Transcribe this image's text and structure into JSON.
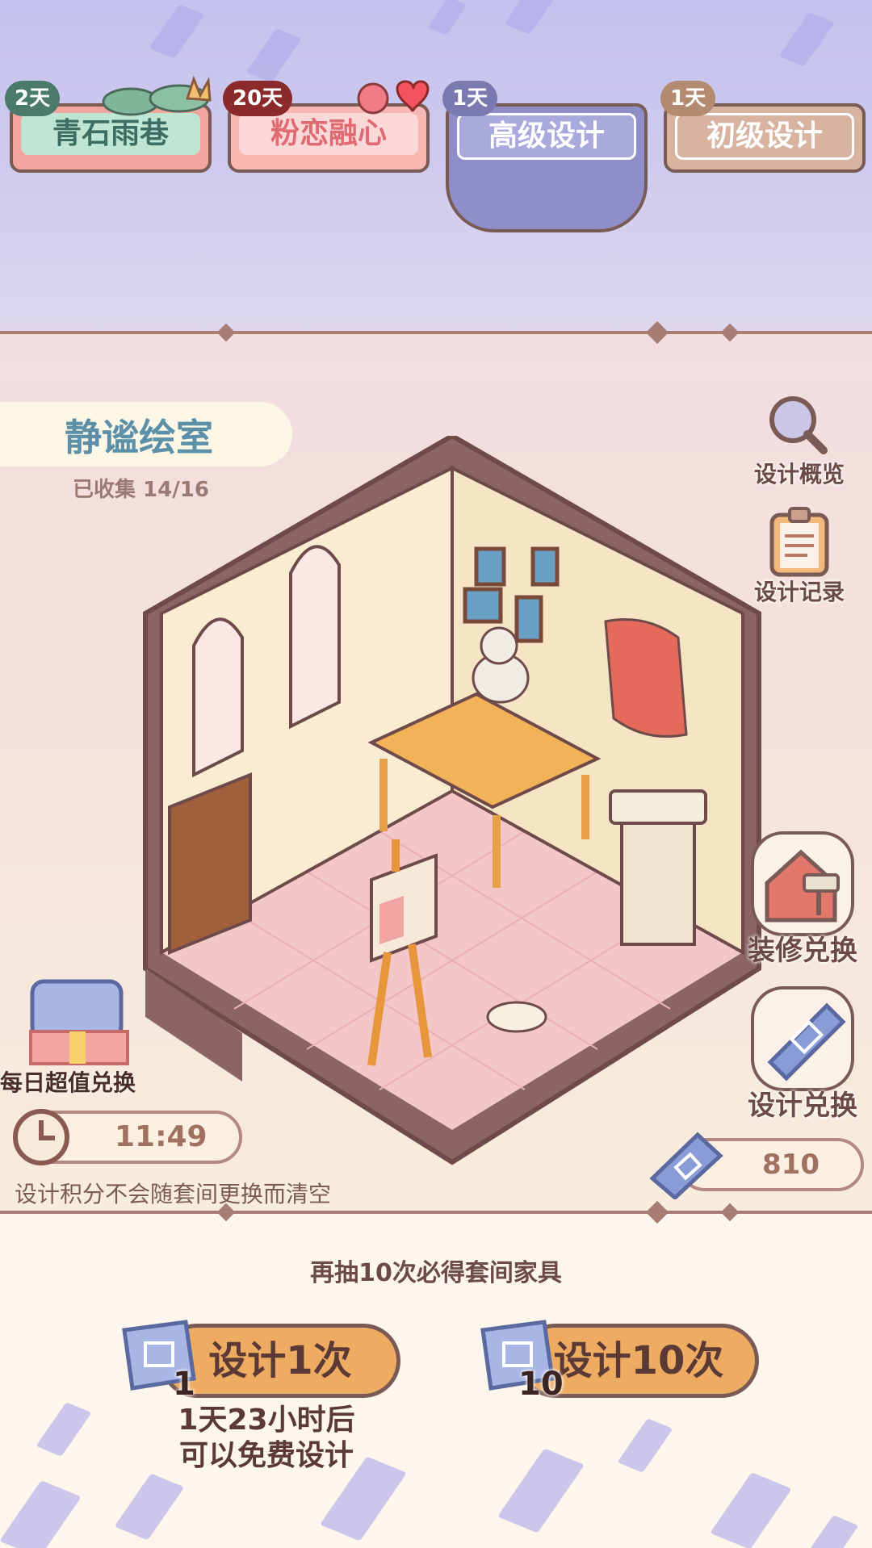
{
  "tabs": [
    {
      "label": "青石雨巷",
      "badge": "2天",
      "badge_color": "#4a7a6a"
    },
    {
      "label": "粉恋融心",
      "badge": "20天",
      "badge_color": "#8a2a2a"
    },
    {
      "label": "高级设计",
      "badge": "1天",
      "badge_color": "#7a7ab0"
    },
    {
      "label": "初级设计",
      "badge": "1天",
      "badge_color": "#b48a70"
    }
  ],
  "room": {
    "name": "静谧绘室",
    "collected": "已收集 14/16"
  },
  "side_buttons": {
    "overview": "设计概览",
    "records": "设计记录",
    "decor_exchange": "装修兑换",
    "design_exchange": "设计兑换"
  },
  "daily_deal": "每日超值兑换",
  "timer": "11:49",
  "points_note": "设计积分不会随套间更换而清空",
  "points": "810",
  "pity_text": "再抽10次必得套间家具",
  "draw_once": {
    "label": "设计1次",
    "cost": "1"
  },
  "draw_ten": {
    "label": "设计10次",
    "cost": "10"
  },
  "free_text": [
    "1天23小时后",
    "可以免费设计"
  ],
  "colors": {
    "accent": "#eeac63",
    "frame": "#7a5a55",
    "top_bg": "#c4c1ee"
  },
  "icons": [
    "magnifier-icon",
    "clipboard-icon",
    "house-roller-icon",
    "ticket-icon",
    "clock-icon",
    "gift-scroll-icon",
    "scroll-icon"
  ]
}
